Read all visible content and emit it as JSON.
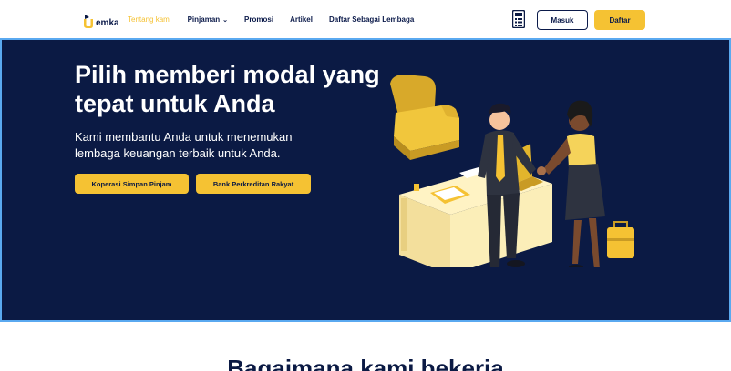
{
  "brand": {
    "name": "emka",
    "colors": {
      "navy": "#0b1a44",
      "accent": "#f5c233"
    }
  },
  "nav": {
    "items": [
      {
        "label": "Tentang kami",
        "active": true
      },
      {
        "label": "Pinjaman",
        "has_dropdown": true
      },
      {
        "label": "Promosi"
      },
      {
        "label": "Artikel"
      },
      {
        "label": "Daftar Sebagai Lembaga"
      }
    ],
    "calculator_icon": "calculator-icon",
    "login_label": "Masuk",
    "register_label": "Daftar"
  },
  "hero": {
    "title": "Pilih memberi modal yang tepat untuk Anda",
    "subtitle": "Kami membantu Anda untuk menemukan lembaga keuangan terbaik untuk Anda.",
    "buttons": [
      {
        "label": "Koperasi Simpan Pinjam"
      },
      {
        "label": "Bank Perkreditan Rakyat"
      }
    ],
    "illustration": "business-handshake-illustration"
  },
  "next_section": {
    "heading": "Bagaimana kami bekerja"
  }
}
